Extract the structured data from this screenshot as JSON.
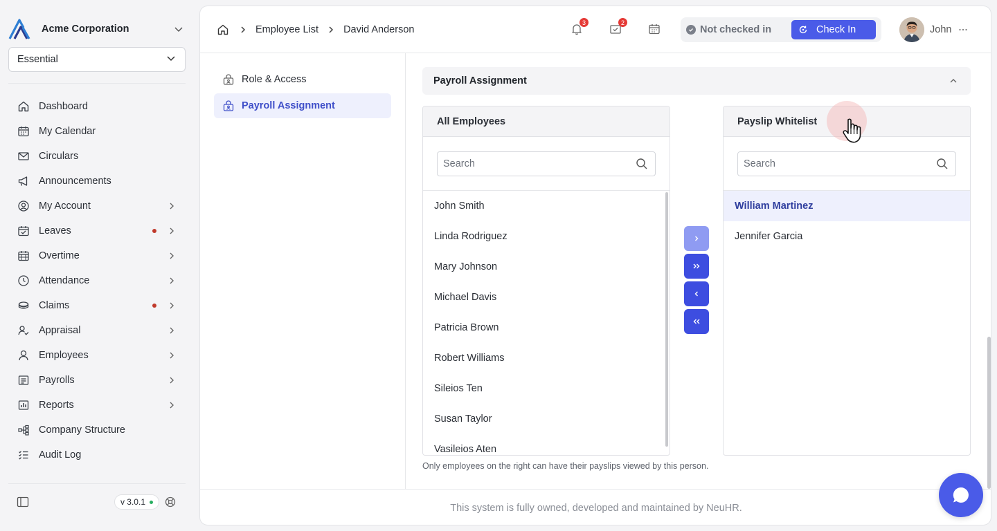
{
  "org": {
    "name": "Acme Corporation"
  },
  "plan": {
    "selected": "Essential"
  },
  "sidebar": {
    "items": [
      {
        "label": "Dashboard",
        "icon": "home-icon",
        "chevron": false,
        "dot": false
      },
      {
        "label": "My Calendar",
        "icon": "calendar-icon",
        "chevron": false,
        "dot": false
      },
      {
        "label": "Circulars",
        "icon": "mail-icon",
        "chevron": false,
        "dot": false
      },
      {
        "label": "Announcements",
        "icon": "megaphone-icon",
        "chevron": false,
        "dot": false
      },
      {
        "label": "My Account",
        "icon": "user-circle-icon",
        "chevron": true,
        "dot": false
      },
      {
        "label": "Leaves",
        "icon": "calendar-check-icon",
        "chevron": true,
        "dot": true
      },
      {
        "label": "Overtime",
        "icon": "calendar-grid-icon",
        "chevron": true,
        "dot": false
      },
      {
        "label": "Attendance",
        "icon": "clock-icon",
        "chevron": true,
        "dot": false
      },
      {
        "label": "Claims",
        "icon": "coins-icon",
        "chevron": true,
        "dot": true
      },
      {
        "label": "Appraisal",
        "icon": "user-check-icon",
        "chevron": true,
        "dot": false
      },
      {
        "label": "Employees",
        "icon": "user-icon",
        "chevron": true,
        "dot": false
      },
      {
        "label": "Payrolls",
        "icon": "receipt-icon",
        "chevron": true,
        "dot": false
      },
      {
        "label": "Reports",
        "icon": "report-icon",
        "chevron": true,
        "dot": false
      },
      {
        "label": "Company Structure",
        "icon": "hierarchy-icon",
        "chevron": false,
        "dot": false
      },
      {
        "label": "Audit Log",
        "icon": "checklist-icon",
        "chevron": false,
        "dot": false
      }
    ],
    "version": "v 3.0.1"
  },
  "breadcrumb": {
    "items": [
      "Employee List",
      "David Anderson"
    ]
  },
  "topbar": {
    "notifications_count": "3",
    "tasks_count": "2",
    "checkin_status": "Not checked in",
    "checkin_button": "Check In",
    "user_name": "John"
  },
  "subnav": {
    "items": [
      {
        "label": "Role & Access",
        "active": false
      },
      {
        "label": "Payroll Assignment",
        "active": true
      }
    ]
  },
  "section": {
    "title": "Payroll Assignment"
  },
  "all_employees": {
    "title": "All Employees",
    "search_placeholder": "Search",
    "items": [
      "John Smith",
      "Linda Rodriguez",
      "Mary Johnson",
      "Michael Davis",
      "Patricia Brown",
      "Robert Williams",
      "Sileios Ten",
      "Susan Taylor",
      "Vasileios Aten"
    ]
  },
  "whitelist": {
    "title": "Payslip Whitelist",
    "search_placeholder": "Search",
    "items": [
      "William Martinez",
      "Jennifer Garcia"
    ],
    "selected": "William Martinez"
  },
  "hint": "Only employees on the right can have their payslips viewed by this person.",
  "footer": "This system is fully owned, developed and maintained by NeuHR.",
  "colors": {
    "accent": "#4a5be8",
    "accent_light": "#8f9bf2",
    "selected_bg": "#eef0fd",
    "badge": "#e53935"
  }
}
